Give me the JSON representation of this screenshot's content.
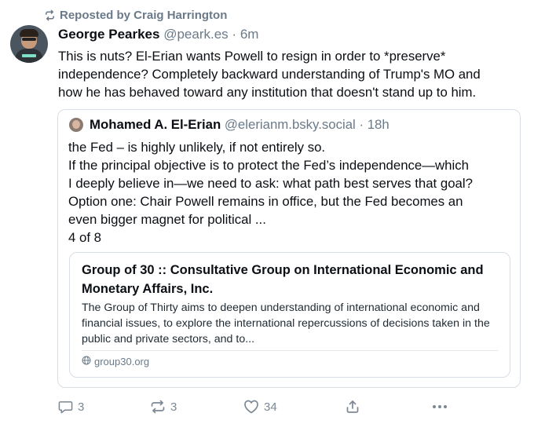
{
  "repost": {
    "label": "Reposted by Craig Harrington"
  },
  "post": {
    "author_name": "George Pearkes",
    "author_handle": "@peark.es",
    "separator": "·",
    "time": "6m",
    "text": "This is nuts? El-Erian wants Powell to resign in order to *preserve*\nindependence? Completely backward understanding of Trump's MO and\nhow he has behaved toward any institution that doesn't stand up to him."
  },
  "quote": {
    "author_name": "Mohamed A. El-Erian",
    "author_handle": "@elerianm.bsky.social",
    "separator": "·",
    "time": "18h",
    "text": "the Fed – is highly unlikely, if not entirely so.\nIf the principal objective is to protect the Fed’s independence—which\nI deeply believe in—we need to ask: what path best serves that goal?\nOption one: Chair Powell remains in office, but the Fed becomes an\neven bigger magnet for political ...\n4 of 8",
    "link_card": {
      "title": "Group of 30 :: Consultative Group on International Economic and Monetary Affairs, Inc.",
      "description": "The Group of Thirty aims to deepen understanding of international economic and financial issues, to explore the international repercussions of decisions taken in the public and private sectors, and to...",
      "domain": "group30.org"
    }
  },
  "actions": {
    "reply_count": "3",
    "repost_count": "3",
    "like_count": "34"
  },
  "icons": {
    "repost": "repost-icon",
    "reply": "reply-icon",
    "like": "heart-icon",
    "share": "share-icon",
    "more": "more-icon",
    "globe": "globe-icon"
  },
  "colors": {
    "muted": "#6b7a89",
    "text": "#0b0f14",
    "border": "#d7dee6"
  }
}
